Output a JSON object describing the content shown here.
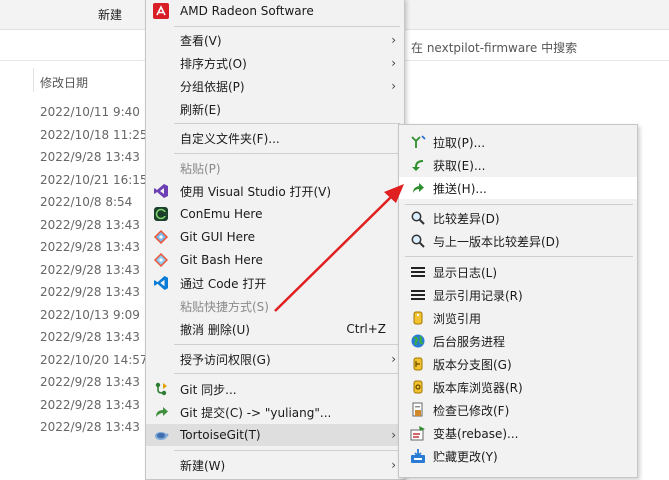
{
  "toolbar": {
    "new_label": "新建"
  },
  "search": {
    "placeholder": "在 nextpilot-firmware 中搜索"
  },
  "file_list": {
    "column_modified": "修改日期",
    "dates": [
      "2022/10/11 9:40",
      "2022/10/18 11:25",
      "2022/9/28 13:43",
      "2022/10/21 16:15",
      "2022/10/8 8:54",
      "2022/9/28 13:43",
      "2022/9/28 13:43",
      "2022/9/28 13:43",
      "2022/9/28 13:43",
      "2022/10/13 9:09",
      "2022/9/28 13:43",
      "2022/10/20 14:57",
      "2022/9/28 13:43",
      "2022/9/28 13:43",
      "2022/9/28 13:43"
    ]
  },
  "context_menu": {
    "amd": "AMD Radeon Software",
    "view": "查看(V)",
    "sort": "排序方式(O)",
    "group": "分组依据(P)",
    "refresh": "刷新(E)",
    "customize": "自定义文件夹(F)...",
    "paste": "粘贴(P)",
    "open_vs": "使用 Visual Studio 打开(V)",
    "conemu": "ConEmu Here",
    "git_gui": "Git GUI Here",
    "git_bash": "Git Bash Here",
    "open_code": "通过 Code 打开",
    "paste_shortcut": "粘贴快捷方式(S)",
    "undo_delete": "撤消 删除(U)",
    "undo_shortcut": "Ctrl+Z",
    "grant_access": "授予访问权限(G)",
    "git_sync": "Git 同步...",
    "git_commit": "Git 提交(C) -> \"yuliang\"...",
    "tortoisegit": "TortoiseGit(T)",
    "new": "新建(W)"
  },
  "tortoise_submenu": {
    "pull": "拉取(P)...",
    "fetch": "获取(E)...",
    "push": "推送(H)...",
    "diff": "比较差异(D)",
    "diff_prev": "与上一版本比较差异(D)",
    "show_log": "显示日志(L)",
    "show_reflog": "显示引用记录(R)",
    "browse_refs": "浏览引用",
    "daemon": "后台服务进程",
    "revision_graph": "版本分支图(G)",
    "repo_browser": "版本库浏览器(R)",
    "check_mods": "检查已修改(F)",
    "rebase": "变基(rebase)...",
    "stash": "贮藏更改(Y)"
  }
}
